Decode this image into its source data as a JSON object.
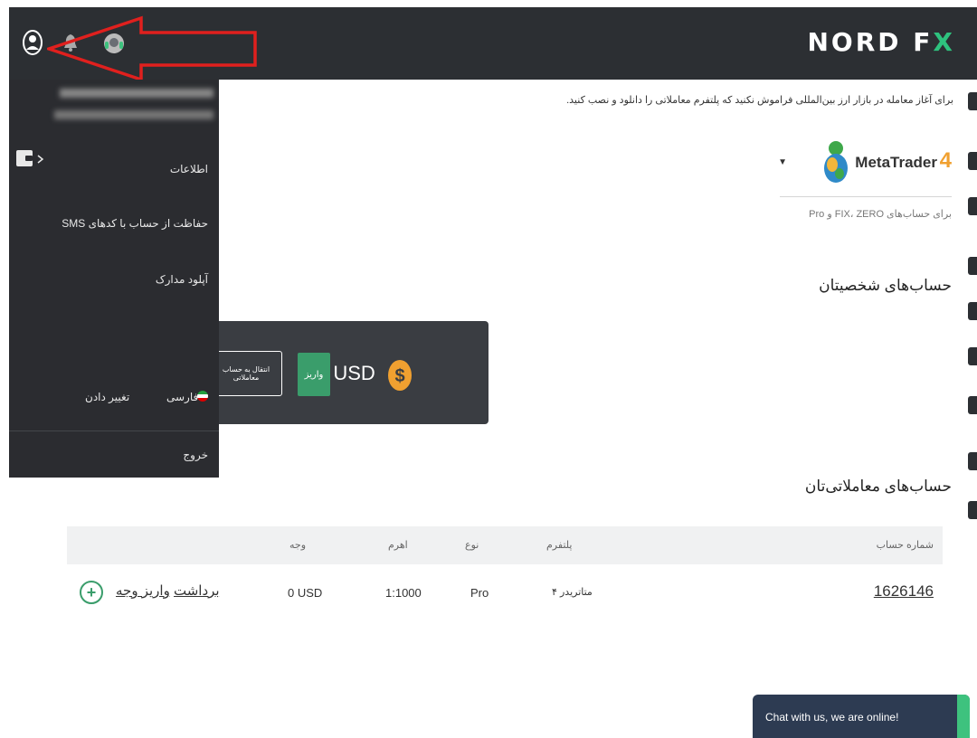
{
  "header": {
    "logo_main": "NORD F",
    "logo_accent": "X",
    "icons": [
      "user-icon",
      "bell-icon",
      "support-icon"
    ]
  },
  "intro_text": "برای آغاز معامله در بازار ارز بین‌المللی فراموش نکنید که پلتفرم معاملاتی را دانلود و نصب کنید.",
  "platform": {
    "name": "MetaTrader",
    "version": "4",
    "subtitle": "برای حساب‌های FIX، ZERO و Pro"
  },
  "personal": {
    "heading": "حساب‌های شخصیتان",
    "balance": "0 USD",
    "deposit_label": "واریز",
    "transfer_label": "انتقال به حساب معاملاتی"
  },
  "trading": {
    "heading": "حساب‌های معاملاتی‌تان",
    "columns": [
      "شماره حساب",
      "پلتفرم",
      "نوع",
      "اهرم",
      "وجه"
    ],
    "rows": [
      {
        "account": "1626146",
        "platform": "متاتریدر ۴",
        "type": "Pro",
        "leverage": "1:1000",
        "funds": "0 USD",
        "withdraw": "برداشت",
        "deposit": "واریز وجه"
      }
    ]
  },
  "sidebar": {
    "menu": [
      "اطلاعات",
      "حفاظت از حساب با کدهای SMS",
      "آپلود مدارک"
    ],
    "language": "فارسی",
    "change_language": "تغییر دادن",
    "logout": "خروج"
  },
  "chat": {
    "label": "Chat with us, we are online!"
  },
  "colors": {
    "header_bg": "#2c2f33",
    "sidebar_bg": "#2b2c30",
    "accent_green": "#3a9d6b",
    "annotation_red": "#e0201e",
    "dollar_gold": "#f0a030"
  }
}
